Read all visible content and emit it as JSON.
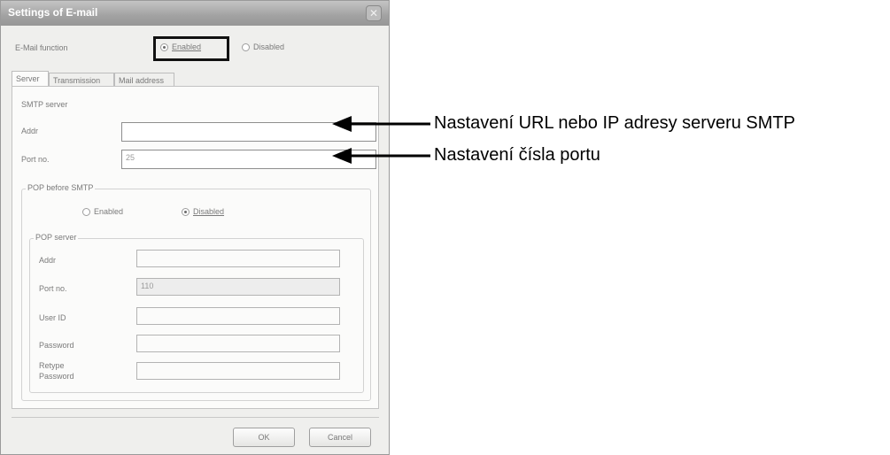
{
  "window": {
    "title": "Settings of E-mail",
    "email_function_label": "E-Mail function",
    "enable_label": "Enabled",
    "disable_label": "Disabled",
    "tabs": [
      {
        "label": "Server"
      },
      {
        "label": "Transmission"
      },
      {
        "label": "Mail address"
      }
    ],
    "smtp_group": "SMTP server",
    "addr_label": "Addr",
    "addr_value": "",
    "port_label": "Port no.",
    "port_value": "25",
    "pop_group": "POP before SMTP",
    "pop_enable_label": "Enabled",
    "pop_disable_label": "Disabled",
    "pop_server_group": "POP server",
    "pop_addr_label": "Addr",
    "pop_port_label": "Port no.",
    "pop_port_value": "110",
    "user_id_label": "User ID",
    "password_label": "Password",
    "retype_label_1": "Retype",
    "retype_label_2": "Password",
    "ok_label": "OK",
    "cancel_label": "Cancel"
  },
  "annotations": {
    "addr": "Nastavení URL nebo IP adresy serveru SMTP",
    "port": "Nastavení čísla portu"
  }
}
